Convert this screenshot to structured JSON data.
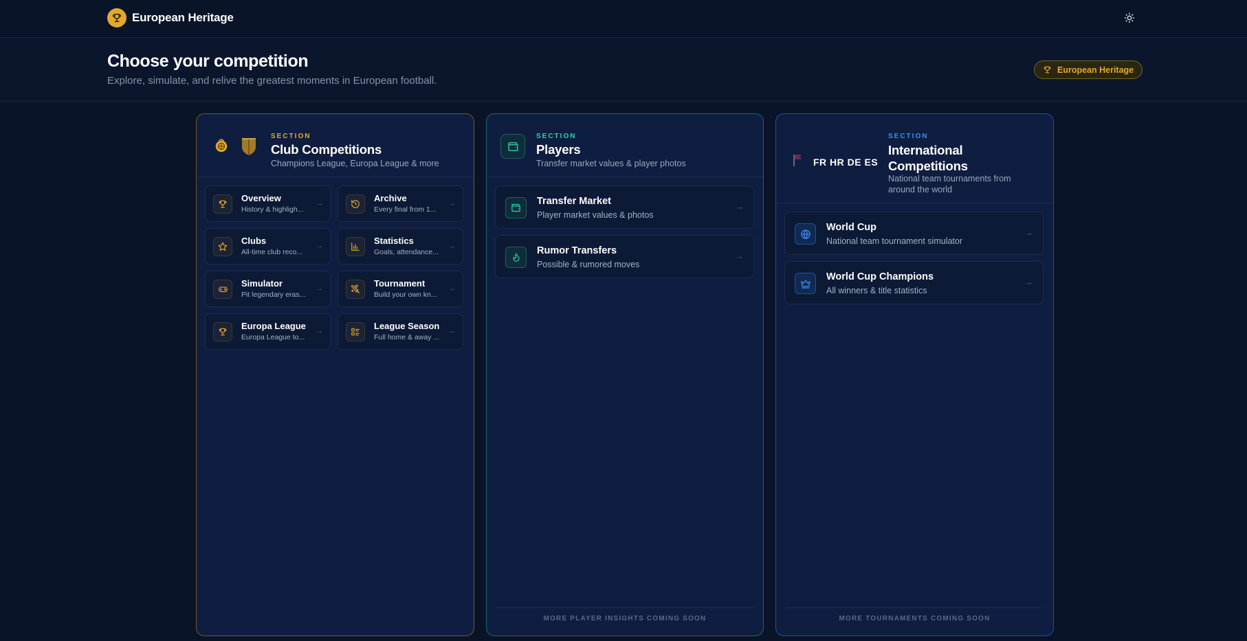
{
  "nav": {
    "brand_title": "European Heritage",
    "brand_icon": "trophy-icon",
    "theme_icon": "sun-icon"
  },
  "header": {
    "title": "Choose your competition",
    "subtitle": "Explore, simulate, and relive the greatest moments in European football.",
    "badge": "European Heritage"
  },
  "colors": {
    "background": "#0a1428",
    "gold": "#e2a92c",
    "teal": "#2fd1ad",
    "blue": "#3d8bf0"
  },
  "club": {
    "section_tag": "SECTION",
    "title": "Club Competitions",
    "desc": "Champions League, Europa League & more",
    "items": [
      {
        "title": "Overview",
        "sub": "History & highligh...",
        "icon": "trophy-icon"
      },
      {
        "title": "Archive",
        "sub": "Every final from 1...",
        "icon": "history-icon"
      },
      {
        "title": "Clubs",
        "sub": "All-time club reco...",
        "icon": "star-icon"
      },
      {
        "title": "Statistics",
        "sub": "Goals, attendance...",
        "icon": "bar-chart-icon"
      },
      {
        "title": "Simulator",
        "sub": "Pit legendary eras...",
        "icon": "gamepad-icon"
      },
      {
        "title": "Tournament",
        "sub": "Build your own kn...",
        "icon": "swords-icon"
      },
      {
        "title": "Europa League",
        "sub": "Europa League to...",
        "icon": "trophy-icon"
      },
      {
        "title": "League Season",
        "sub": "Full home & away ...",
        "icon": "list-icon"
      }
    ]
  },
  "players": {
    "section_tag": "SECTION",
    "title": "Players",
    "desc": "Transfer market values & player photos",
    "items": [
      {
        "title": "Transfer Market",
        "sub": "Player market values & photos",
        "icon": "wallet-icon"
      },
      {
        "title": "Rumor Transfers",
        "sub": "Possible & rumored moves",
        "icon": "flame-icon"
      }
    ],
    "footer": "MORE PLAYER INSIGHTS COMING SOON"
  },
  "international": {
    "flags": "FR HR DE ES",
    "section_tag": "SECTION",
    "title": "International Competitions",
    "desc": "National team tournaments from around the world",
    "items": [
      {
        "title": "World Cup",
        "sub": "National team tournament simulator",
        "icon": "globe-icon"
      },
      {
        "title": "World Cup Champions",
        "sub": "All winners & title statistics",
        "icon": "crown-icon"
      }
    ],
    "footer": "MORE TOURNAMENTS COMING SOON"
  }
}
